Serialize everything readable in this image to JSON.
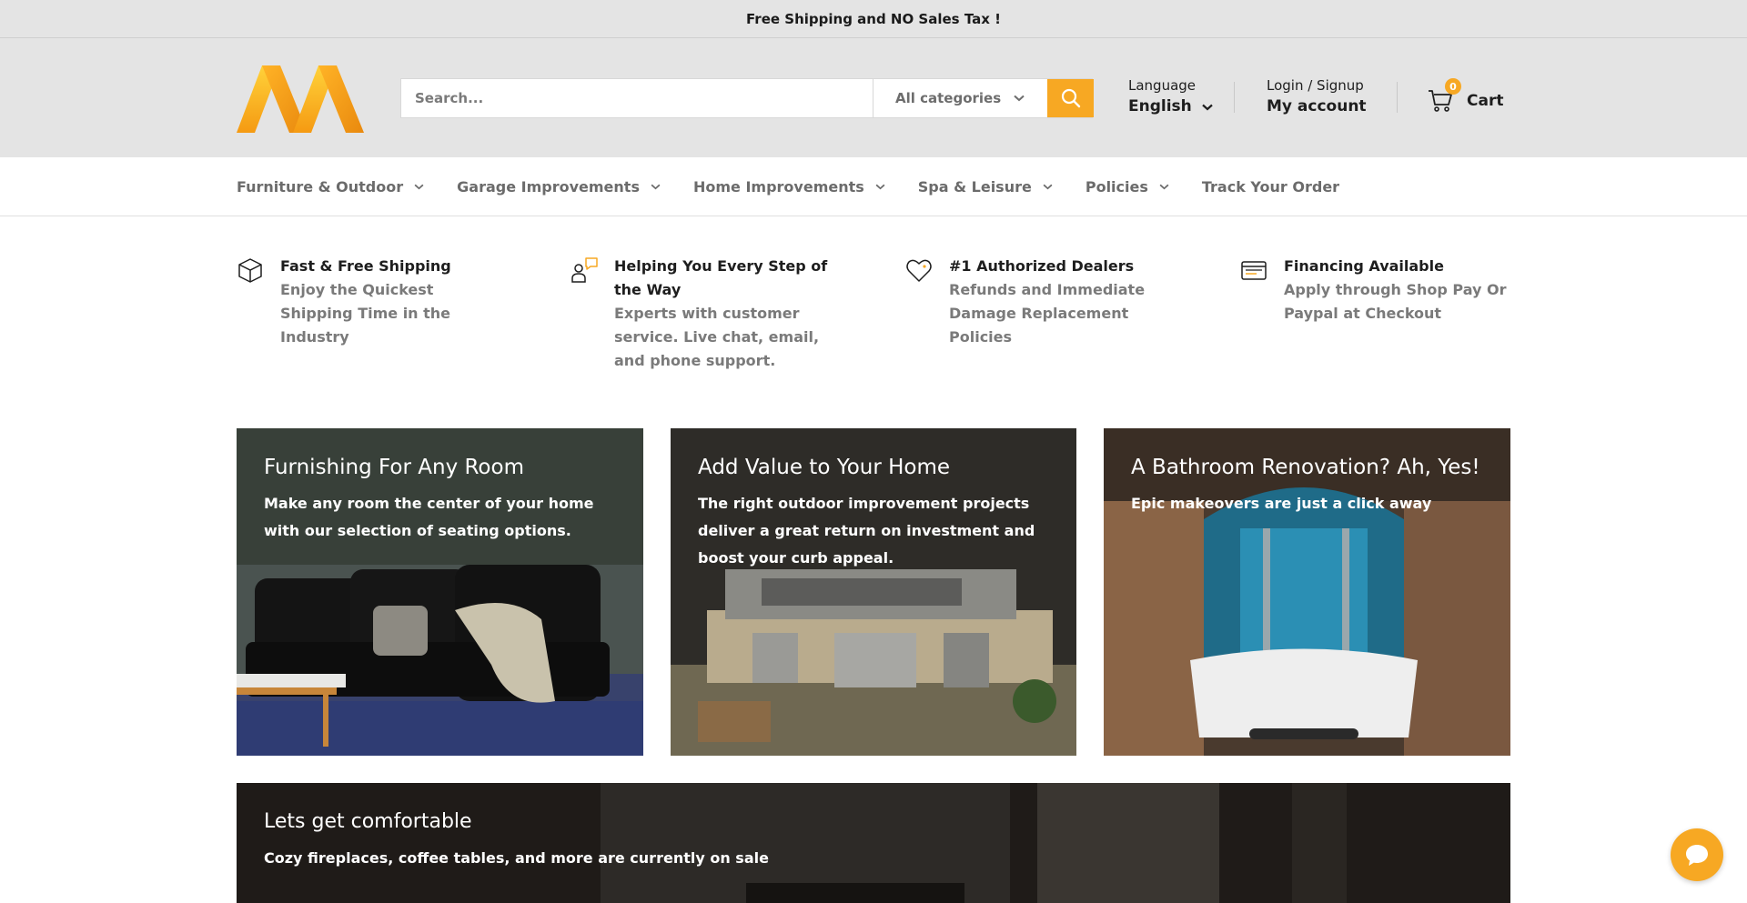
{
  "announcement": "Free Shipping and NO Sales Tax !",
  "search": {
    "placeholder": "Search...",
    "category": "All categories"
  },
  "language": {
    "label": "Language",
    "value": "English"
  },
  "account": {
    "label": "Login / Signup",
    "value": "My account"
  },
  "cart": {
    "count": "0",
    "label": "Cart"
  },
  "nav": [
    {
      "label": "Furniture & Outdoor"
    },
    {
      "label": "Garage Improvements"
    },
    {
      "label": "Home Improvements"
    },
    {
      "label": "Spa & Leisure"
    },
    {
      "label": "Policies"
    },
    {
      "label": "Track Your Order"
    }
  ],
  "features": [
    {
      "icon": "box-icon",
      "title": "Fast & Free Shipping",
      "text": "Enjoy the Quickest Shipping Time in the Industry"
    },
    {
      "icon": "support-agent-icon",
      "title": "Helping You Every Step of the Way",
      "text": "Experts with customer service. Live chat, email, and phone support."
    },
    {
      "icon": "heart-icon",
      "title": "#1 Authorized Dealers",
      "text": "Refunds and Immediate Damage Replacement Policies"
    },
    {
      "icon": "credit-card-icon",
      "title": "Financing Available",
      "text": "Apply through Shop Pay Or Paypal at Checkout"
    }
  ],
  "cards": [
    {
      "title": "Furnishing For Any Room",
      "text": "Make any room the center of your home with our selection of seating options."
    },
    {
      "title": "Add Value to Your Home",
      "text": "The right outdoor improvement projects deliver a great return on investment and boost your curb appeal."
    },
    {
      "title": "A Bathroom Renovation? Ah, Yes!",
      "text": "Epic makeovers are just a click away"
    }
  ],
  "banner": {
    "title": "Lets get comfortable",
    "text": "Cozy fireplaces, coffee tables, and more are currently on sale"
  },
  "colors": {
    "accent": "#f7a823",
    "header_bg": "#e4e4e4",
    "nav_text": "#6b6b6b",
    "muted_text": "#7a7a7a"
  }
}
